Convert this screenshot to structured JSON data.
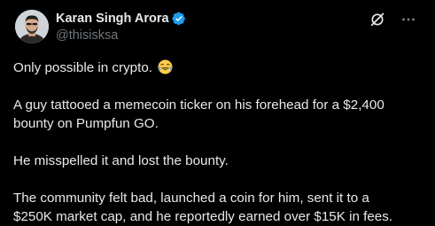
{
  "author": {
    "display_name": "Karan Singh Arora",
    "handle": "@thisisksa",
    "avatar_icon": "avatar-photo",
    "verified_icon": "verified-badge-icon",
    "verified_color": "#1d9bf0"
  },
  "actions": {
    "grok_icon": "grok-icon",
    "more_icon": "more-horizontal-icon"
  },
  "post": {
    "para1": "Only possible in crypto.",
    "para1_emoji": "face-with-tears-of-joy",
    "para2_line1": "A guy tattooed a memecoin ticker on his forehead for a $2,400",
    "para2_line2": "bounty on Pumpfun GO.",
    "para3": "He misspelled it and lost the bounty.",
    "para4_line1": "The community felt bad, launched a coin for him, sent it to a",
    "para4_line2": "$250K market cap, and he reportedly earned over $15K in fees."
  },
  "colors": {
    "background": "#000000",
    "text": "#e7e9ea",
    "secondary_text": "#71767b",
    "accent": "#1d9bf0"
  }
}
